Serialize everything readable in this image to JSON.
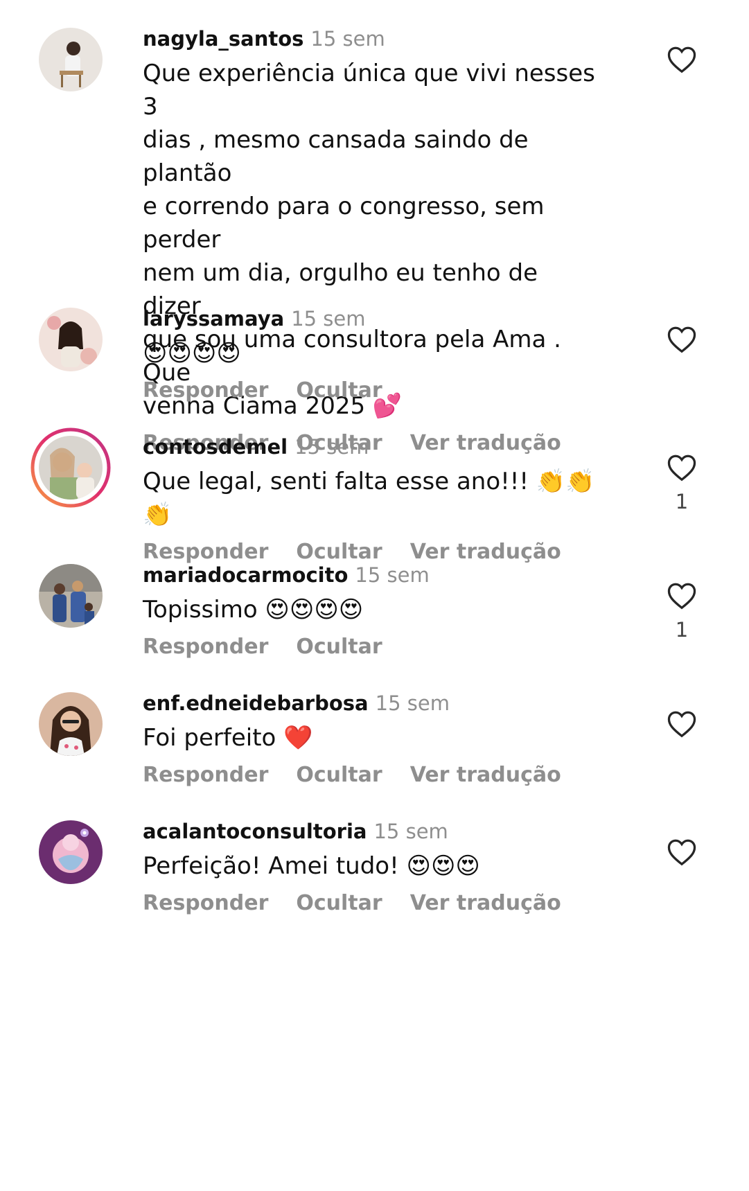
{
  "actions": {
    "reply": "Responder",
    "hide": "Ocultar",
    "translate": "Ver tradução"
  },
  "comments": [
    {
      "username": "nagyla_santos",
      "time": "15 sem",
      "lines": [
        "Que experiência única que vivi nesses 3",
        "dias , mesmo cansada saindo de plantão",
        "e correndo para o congresso, sem perder",
        "nem um dia, orgulho eu tenho de dizer",
        "que sou uma consultora pela Ama . Que",
        "venha Ciama 2025 💕"
      ],
      "likes": ""
    },
    {
      "username": "laryssamaya",
      "time": "15 sem",
      "text": "😍😍😍😍",
      "likes": ""
    },
    {
      "username": "contosdemel",
      "time": "15 sem",
      "text": "Que legal, senti falta esse ano!!! 👏👏👏",
      "likes": "1"
    },
    {
      "username": "mariadocarmocito",
      "time": "15 sem",
      "text": "Topissimo 😍😍😍😍",
      "likes": "1"
    },
    {
      "username": "enf.edneidebarbosa",
      "time": "15 sem",
      "text": "Foi perfeito ❤️",
      "likes": ""
    },
    {
      "username": "acalantoconsultoria",
      "time": "15 sem",
      "text": "Perfeição! Amei tudo! 😍😍😍",
      "likes": ""
    }
  ],
  "colors": {
    "muted": "#8e8e8e",
    "text": "#111111",
    "story_ring_start": "#f9a03f",
    "story_ring_end": "#c13584"
  }
}
